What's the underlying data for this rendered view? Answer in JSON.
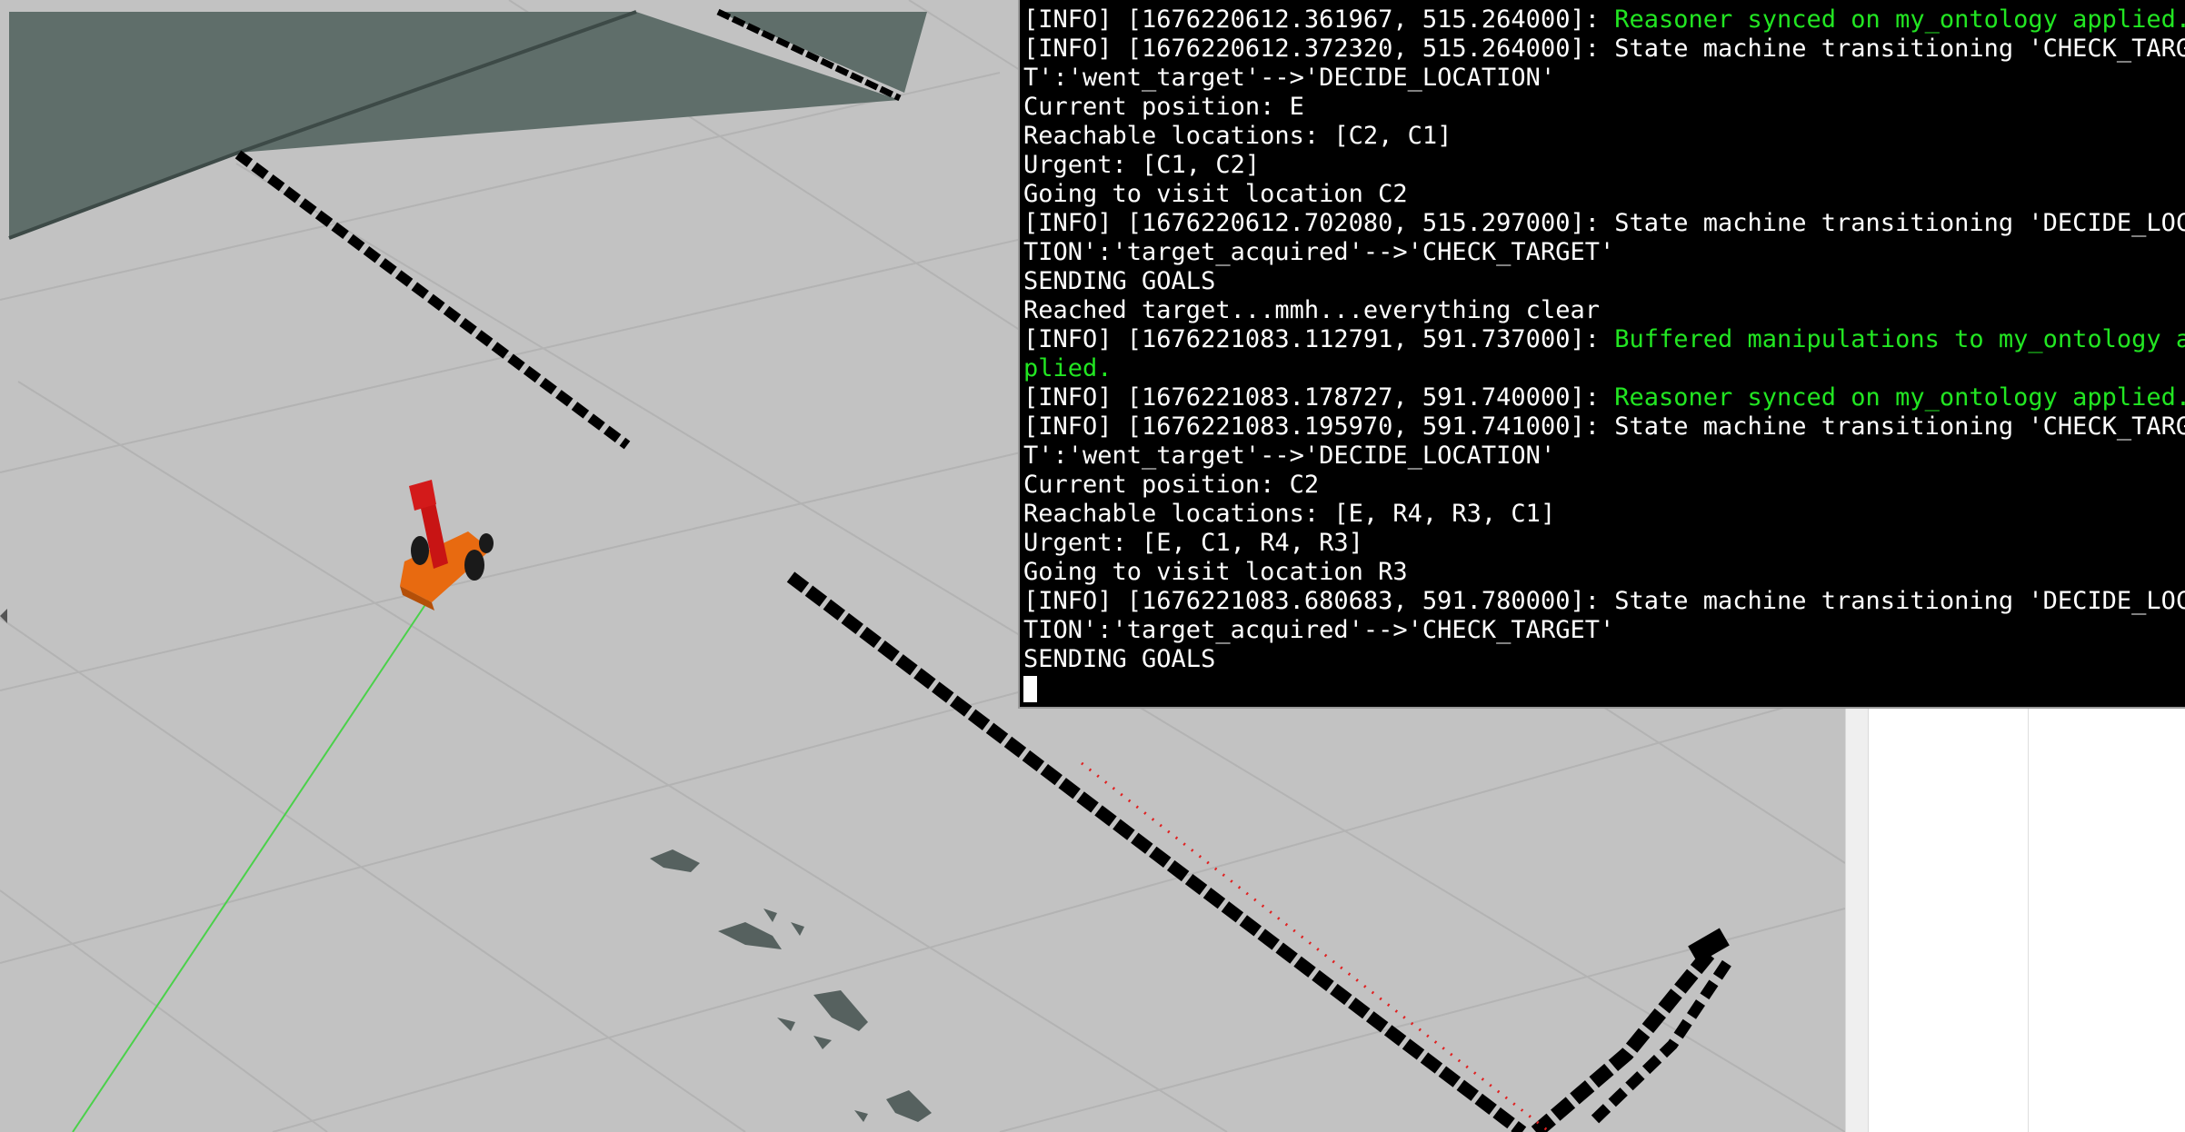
{
  "window": {
    "viewport_label": "",
    "icons": [
      "collapse-panel-arrow-icon",
      "robot-model",
      "occupancy-map"
    ]
  },
  "colors": {
    "floor": "#c2c2c2",
    "floor_grid": "#b3b3b3",
    "map_wall_shade": "#5f6e6a",
    "map_obstacle": "#000000",
    "robot_base": "#e86a10",
    "robot_arm": "#c81414",
    "robot_wheel": "#1a1a1a",
    "path_line": "#4ad14a",
    "laser_points": "#e02020",
    "small_obstacles": "#56615f",
    "terminal_bg": "#000000",
    "terminal_text": "#ffffff",
    "terminal_green": "#22e622"
  },
  "terminal": {
    "lines": [
      {
        "segments": [
          {
            "text": "[INFO] [1676220612.361967, 515.264000]: ",
            "color": "white"
          },
          {
            "text": "Reasoner synced on my_ontology applied.",
            "color": "green"
          }
        ]
      },
      {
        "segments": [
          {
            "text": "[INFO] [1676220612.372320, 515.264000]: State machine transitioning 'CHECK_TARGE",
            "color": "white"
          }
        ]
      },
      {
        "segments": [
          {
            "text": "T':'went_target'-->'DECIDE_LOCATION'",
            "color": "white"
          }
        ]
      },
      {
        "segments": [
          {
            "text": "Current position: E",
            "color": "white"
          }
        ]
      },
      {
        "segments": [
          {
            "text": "Reachable locations: [C2, C1]",
            "color": "white"
          }
        ]
      },
      {
        "segments": [
          {
            "text": "Urgent: [C1, C2]",
            "color": "white"
          }
        ]
      },
      {
        "segments": [
          {
            "text": "Going to visit location C2",
            "color": "white"
          }
        ]
      },
      {
        "segments": [
          {
            "text": "[INFO] [1676220612.702080, 515.297000]: State machine transitioning 'DECIDE_LOCA",
            "color": "white"
          }
        ]
      },
      {
        "segments": [
          {
            "text": "TION':'target_acquired'-->'CHECK_TARGET'",
            "color": "white"
          }
        ]
      },
      {
        "segments": [
          {
            "text": "SENDING GOALS",
            "color": "white"
          }
        ]
      },
      {
        "segments": [
          {
            "text": "Reached target...mmh...everything clear",
            "color": "white"
          }
        ]
      },
      {
        "segments": [
          {
            "text": "[INFO] [1676221083.112791, 591.737000]: ",
            "color": "white"
          },
          {
            "text": "Buffered manipulations to my_ontology ap",
            "color": "green"
          }
        ]
      },
      {
        "segments": [
          {
            "text": "plied.",
            "color": "green"
          }
        ]
      },
      {
        "segments": [
          {
            "text": "[INFO] [1676221083.178727, 591.740000]: ",
            "color": "white"
          },
          {
            "text": "Reasoner synced on my_ontology applied.",
            "color": "green"
          }
        ]
      },
      {
        "segments": [
          {
            "text": "[INFO] [1676221083.195970, 591.741000]: State machine transitioning 'CHECK_TARGE",
            "color": "white"
          }
        ]
      },
      {
        "segments": [
          {
            "text": "T':'went_target'-->'DECIDE_LOCATION'",
            "color": "white"
          }
        ]
      },
      {
        "segments": [
          {
            "text": "Current position: C2",
            "color": "white"
          }
        ]
      },
      {
        "segments": [
          {
            "text": "Reachable locations: [E, R4, R3, C1]",
            "color": "white"
          }
        ]
      },
      {
        "segments": [
          {
            "text": "Urgent: [E, C1, R4, R3]",
            "color": "white"
          }
        ]
      },
      {
        "segments": [
          {
            "text": "Going to visit location R3",
            "color": "white"
          }
        ]
      },
      {
        "segments": [
          {
            "text": "[INFO] [1676221083.680683, 591.780000]: State machine transitioning 'DECIDE_LOCA",
            "color": "white"
          }
        ]
      },
      {
        "segments": [
          {
            "text": "TION':'target_acquired'-->'CHECK_TARGET'",
            "color": "white"
          }
        ]
      },
      {
        "segments": [
          {
            "text": "SENDING GOALS",
            "color": "white"
          }
        ]
      }
    ]
  }
}
